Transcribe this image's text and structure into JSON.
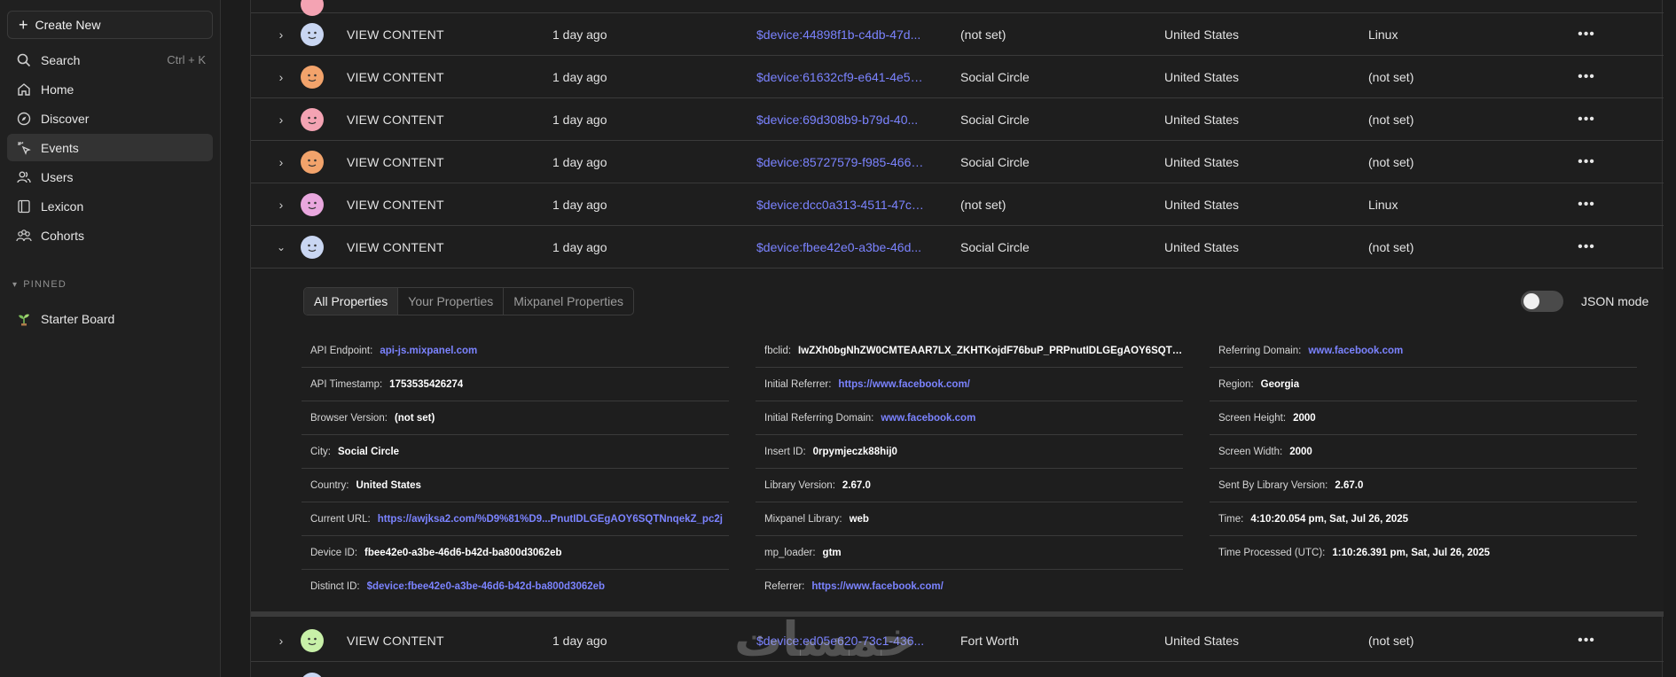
{
  "sidebar": {
    "create_new": "Create New",
    "search": {
      "label": "Search",
      "shortcut": "Ctrl + K"
    },
    "items": [
      {
        "label": "Home",
        "icon": "home-icon"
      },
      {
        "label": "Discover",
        "icon": "compass-icon"
      },
      {
        "label": "Events",
        "icon": "sparkle-cursor-icon",
        "active": true
      },
      {
        "label": "Users",
        "icon": "users-icon"
      },
      {
        "label": "Lexicon",
        "icon": "book-icon"
      },
      {
        "label": "Cohorts",
        "icon": "cohorts-icon"
      }
    ],
    "pinned_label": "PINNED",
    "pinned": [
      {
        "label": "Starter Board",
        "icon": "sprout-icon"
      }
    ]
  },
  "rows": [
    {
      "event": "VIEW CONTENT",
      "time": "1 day ago",
      "device": "$device:44898f1b-c4db-47d...",
      "city": "(not set)",
      "country": "United States",
      "os": "Linux",
      "avatar_color": "#c9d6f2"
    },
    {
      "event": "VIEW CONTENT",
      "time": "1 day ago",
      "device": "$device:61632cf9-e641-4e5b...",
      "city": "Social Circle",
      "country": "United States",
      "os": "(not set)",
      "avatar_color": "#f2a36b"
    },
    {
      "event": "VIEW CONTENT",
      "time": "1 day ago",
      "device": "$device:69d308b9-b79d-40...",
      "city": "Social Circle",
      "country": "United States",
      "os": "(not set)",
      "avatar_color": "#f4a3b3"
    },
    {
      "event": "VIEW CONTENT",
      "time": "1 day ago",
      "device": "$device:85727579-f985-4660...",
      "city": "Social Circle",
      "country": "United States",
      "os": "(not set)",
      "avatar_color": "#f2a36b"
    },
    {
      "event": "VIEW CONTENT",
      "time": "1 day ago",
      "device": "$device:dcc0a313-4511-47c4...",
      "city": "(not set)",
      "country": "United States",
      "os": "Linux",
      "avatar_color": "#e9a7de"
    },
    {
      "event": "VIEW CONTENT",
      "time": "1 day ago",
      "device": "$device:fbee42e0-a3be-46d...",
      "city": "Social Circle",
      "country": "United States",
      "os": "(not set)",
      "avatar_color": "#c9d6f2",
      "expanded": true
    }
  ],
  "last_row": {
    "event": "VIEW CONTENT",
    "time": "1 day ago",
    "device": "$device:ed05e620-73c1-436...",
    "city": "Fort Worth",
    "country": "United States",
    "os": "(not set)",
    "avatar_color": "#c8f0a8"
  },
  "panel": {
    "tabs": [
      "All Properties",
      "Your Properties",
      "Mixpanel Properties"
    ],
    "json_mode": "JSON mode",
    "col1": [
      {
        "k": "API Endpoint:",
        "v": "api-js.mixpanel.com",
        "link": true
      },
      {
        "k": "API Timestamp:",
        "v": "1753535426274"
      },
      {
        "k": "Browser Version:",
        "v": "(not set)"
      },
      {
        "k": "City:",
        "v": "Social Circle"
      },
      {
        "k": "Country:",
        "v": "United States"
      },
      {
        "k": "Current URL:",
        "v": "https://awjksa2.com/%D9%81%D9...PnutIDLGEgAOY6SQTNnqekZ_pc2j",
        "link": true
      },
      {
        "k": "Device ID:",
        "v": "fbee42e0-a3be-46d6-b42d-ba800d3062eb"
      },
      {
        "k": "Distinct ID:",
        "v": "$device:fbee42e0-a3be-46d6-b42d-ba800d3062eb",
        "link": true
      }
    ],
    "col2": [
      {
        "k": "fbclid:",
        "v": "IwZXh0bgNhZW0CMTEAAR7LX_ZKHTKojdF76buP_PRPnutIDLGEgAOY6SQTNn..."
      },
      {
        "k": "Initial Referrer:",
        "v": "https://www.facebook.com/",
        "link": true
      },
      {
        "k": "Initial Referring Domain:",
        "v": "www.facebook.com",
        "link": true
      },
      {
        "k": "Insert ID:",
        "v": "0rpymjeczk88hij0"
      },
      {
        "k": "Library Version:",
        "v": "2.67.0"
      },
      {
        "k": "Mixpanel Library:",
        "v": "web"
      },
      {
        "k": "mp_loader:",
        "v": "gtm"
      },
      {
        "k": "Referrer:",
        "v": "https://www.facebook.com/",
        "link": true
      }
    ],
    "col3": [
      {
        "k": "Referring Domain:",
        "v": "www.facebook.com",
        "link": true
      },
      {
        "k": "Region:",
        "v": "Georgia"
      },
      {
        "k": "Screen Height:",
        "v": "2000"
      },
      {
        "k": "Screen Width:",
        "v": "2000"
      },
      {
        "k": "Sent By Library Version:",
        "v": "2.67.0"
      },
      {
        "k": "Time:",
        "v": "4:10:20.054 pm, Sat, Jul 26, 2025"
      },
      {
        "k": "Time Processed (UTC):",
        "v": "1:10:26.391 pm, Sat, Jul 26, 2025"
      }
    ]
  },
  "watermark": "خمسات"
}
